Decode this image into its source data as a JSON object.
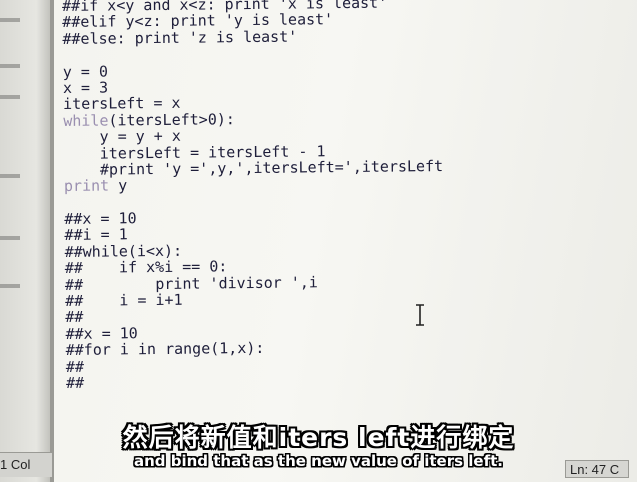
{
  "editor": {
    "lines": [
      "##if x<y and x<z: print 'x is least'",
      "##elif y<z: print 'y is least'",
      "##else: print 'z is least'",
      "",
      "y = 0",
      "x = 3",
      "itersLeft = x",
      "while(itersLeft>0):",
      "    y = y + x",
      "    itersLeft = itersLeft - 1",
      "    #print 'y =',y,',itersLeft=',itersLeft",
      "print y",
      "",
      "##x = 10",
      "##i = 1",
      "##while(i<x):",
      "##    if x%i == 0:",
      "##        print 'divisor ',i",
      "##    i = i+1",
      "##",
      "##x = 10",
      "##for i in range(1,x):",
      "##",
      "##"
    ]
  },
  "status_bar": {
    "left_text": "1 Col",
    "right_text": "Ln: 47 C"
  },
  "subtitles": {
    "chinese": "然后将新值和iters left进行绑定",
    "english": "and bind that as the new value of iters left."
  },
  "colors": {
    "editor_background": "#f3f3ee",
    "code_text": "#1e1e3a",
    "subtitle_text": "#ffffff"
  }
}
